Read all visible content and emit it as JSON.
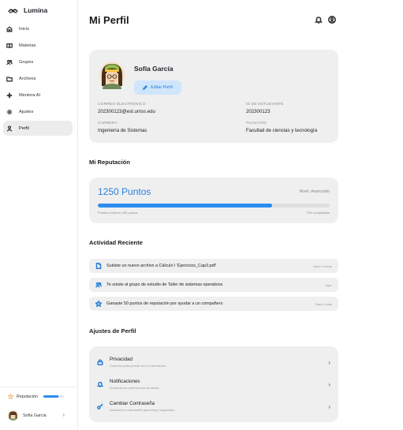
{
  "sidebar": {
    "brand": "Lumina",
    "items": [
      {
        "label": "Inicio"
      },
      {
        "label": "Materias"
      },
      {
        "label": "Grupos"
      },
      {
        "label": "Archivos"
      },
      {
        "label": "Mentora AI"
      },
      {
        "label": "Ajustes"
      },
      {
        "label": "Perfil"
      }
    ],
    "reputation_label": "Reputación",
    "reputation_progress": 0.75,
    "user_name": "Sofía García"
  },
  "header": {
    "title": "Mi Perfil"
  },
  "profile": {
    "name": "Sofía García",
    "edit_label": "Editar Perfil",
    "email_label": "CORREO ELECTRÓNICO",
    "email": "202300123@est.umss.edu",
    "id_label": "ID DE ESTUDIANTE",
    "id": "202300123",
    "career_label": "CARRERA",
    "career": "Ingeniería de Sistemas",
    "faculty_label": "FACULTAD",
    "faculty": "Facultad de ciencias y tecnología"
  },
  "reputation": {
    "section_title": "Mi Reputación",
    "points": "1250 Puntos",
    "level": "Nivel: Avanzado",
    "progress_percent": 75,
    "next_level": "Próximo nivel en 250 puntos",
    "completed": "75% completado"
  },
  "activity": {
    "section_title": "Actividad Reciente",
    "items": [
      {
        "text": "Subiste un nuevo archivo a Cálculo I 'Ejercicios_Cap3.pdf'",
        "time": "Hace 2 horas",
        "icon": "file-icon"
      },
      {
        "text": "Te uniste al grupo de estudio de Taller de sistemas operativos",
        "time": "Ayer",
        "icon": "users-icon"
      },
      {
        "text": "Ganaste 50 puntos de reputación por ayudar a un compañero",
        "time": "Hace 3 días",
        "icon": "star-icon"
      }
    ]
  },
  "settings": {
    "section_title": "Ajustes de Perfil",
    "items": [
      {
        "title": "Privacidad",
        "desc": "Controla quién puede ver tu información.",
        "icon": "lock-icon"
      },
      {
        "title": "Notificaciones",
        "desc": "Gestiona tus preferencias de alerta.",
        "icon": "bell-icon"
      },
      {
        "title": "Cambiar Contraseña",
        "desc": "Actualiza tu contraseña para mayor seguridad.",
        "icon": "key-icon"
      }
    ]
  },
  "colors": {
    "accent": "#2c8cf0",
    "card_bg": "#efefef",
    "edit_button_bg": "#cfe5fb"
  }
}
